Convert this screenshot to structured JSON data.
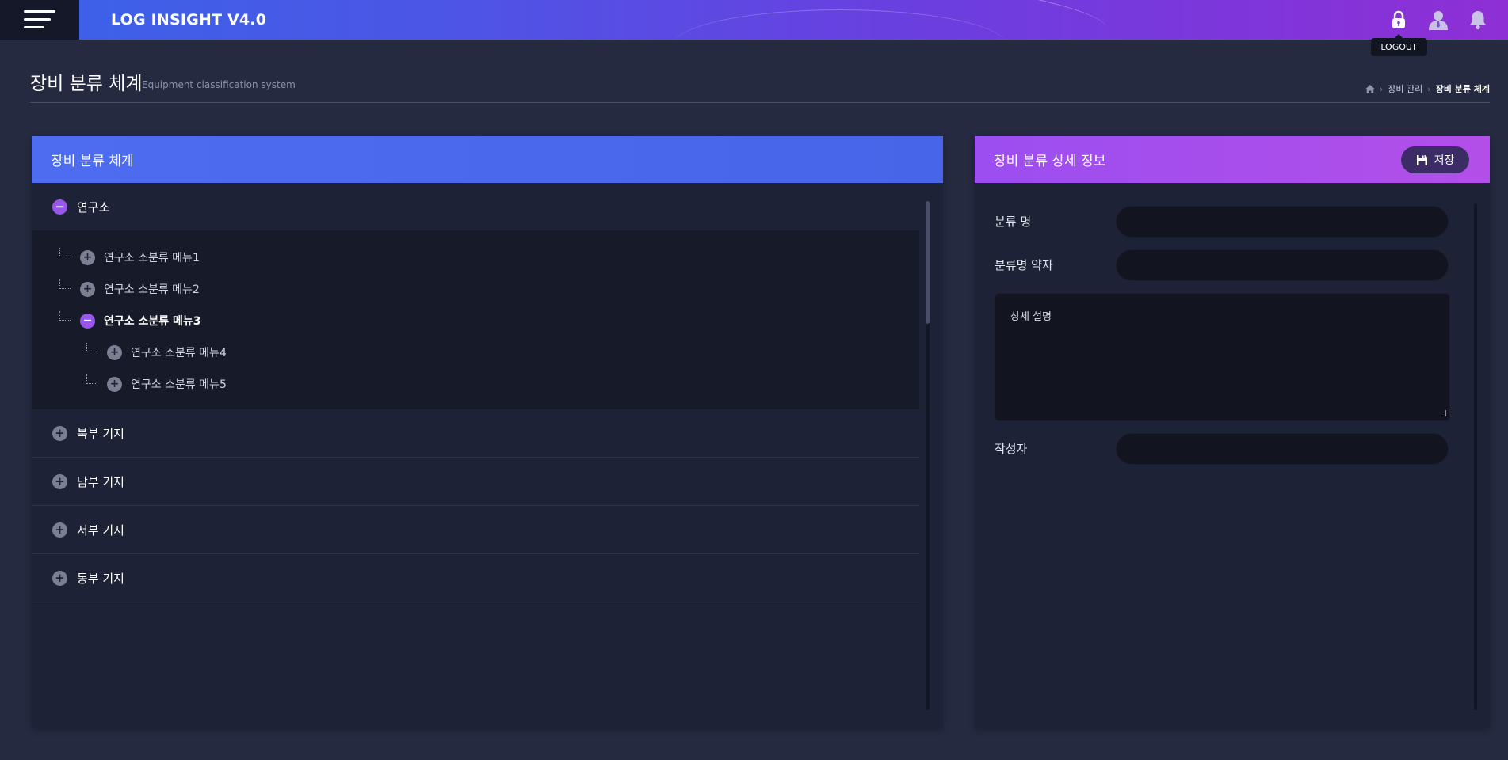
{
  "header": {
    "app_title": "LOG INSIGHT V4.0",
    "icons": [
      "menu-icon",
      "lock-icon",
      "user-icon",
      "bell-icon"
    ],
    "tooltip": "LOGOUT"
  },
  "page": {
    "title": "장비 분류 체계",
    "subtitle": "Equipment classification system",
    "breadcrumb": [
      "장비 관리",
      "장비 분류 체계"
    ]
  },
  "tree_panel": {
    "title": "장비 분류 체계",
    "nodes": [
      {
        "label": "연구소",
        "expanded": true,
        "children": [
          {
            "label": "연구소 소분류 메뉴1",
            "expanded": false,
            "level": 1
          },
          {
            "label": "연구소 소분류 메뉴2",
            "expanded": false,
            "level": 1
          },
          {
            "label": "연구소 소분류 메뉴3",
            "expanded": true,
            "level": 1
          },
          {
            "label": "연구소 소분류 메뉴4",
            "expanded": false,
            "level": 2
          },
          {
            "label": "연구소 소분류 메뉴5",
            "expanded": false,
            "level": 2
          }
        ]
      },
      {
        "label": "북부 기지",
        "expanded": false
      },
      {
        "label": "남부 기지",
        "expanded": false
      },
      {
        "label": "서부 기지",
        "expanded": false
      },
      {
        "label": "동부 기지",
        "expanded": false
      }
    ]
  },
  "detail_panel": {
    "title": "장비 분류 상세 정보",
    "save_label": "저장",
    "fields": {
      "name_label": "분류 명",
      "name_value": "",
      "abbr_label": "분류명 약자",
      "abbr_value": "",
      "description_placeholder": "상세 설명",
      "author_label": "작성자",
      "author_value": ""
    }
  },
  "colors": {
    "header_gradient_start": "#3a63e8",
    "header_gradient_end": "#8e2fd6",
    "tree_header": "#4e6cf0",
    "detail_header": "#9c4ef0",
    "expand_toggle": "#9857ea",
    "background": "#252a41"
  }
}
